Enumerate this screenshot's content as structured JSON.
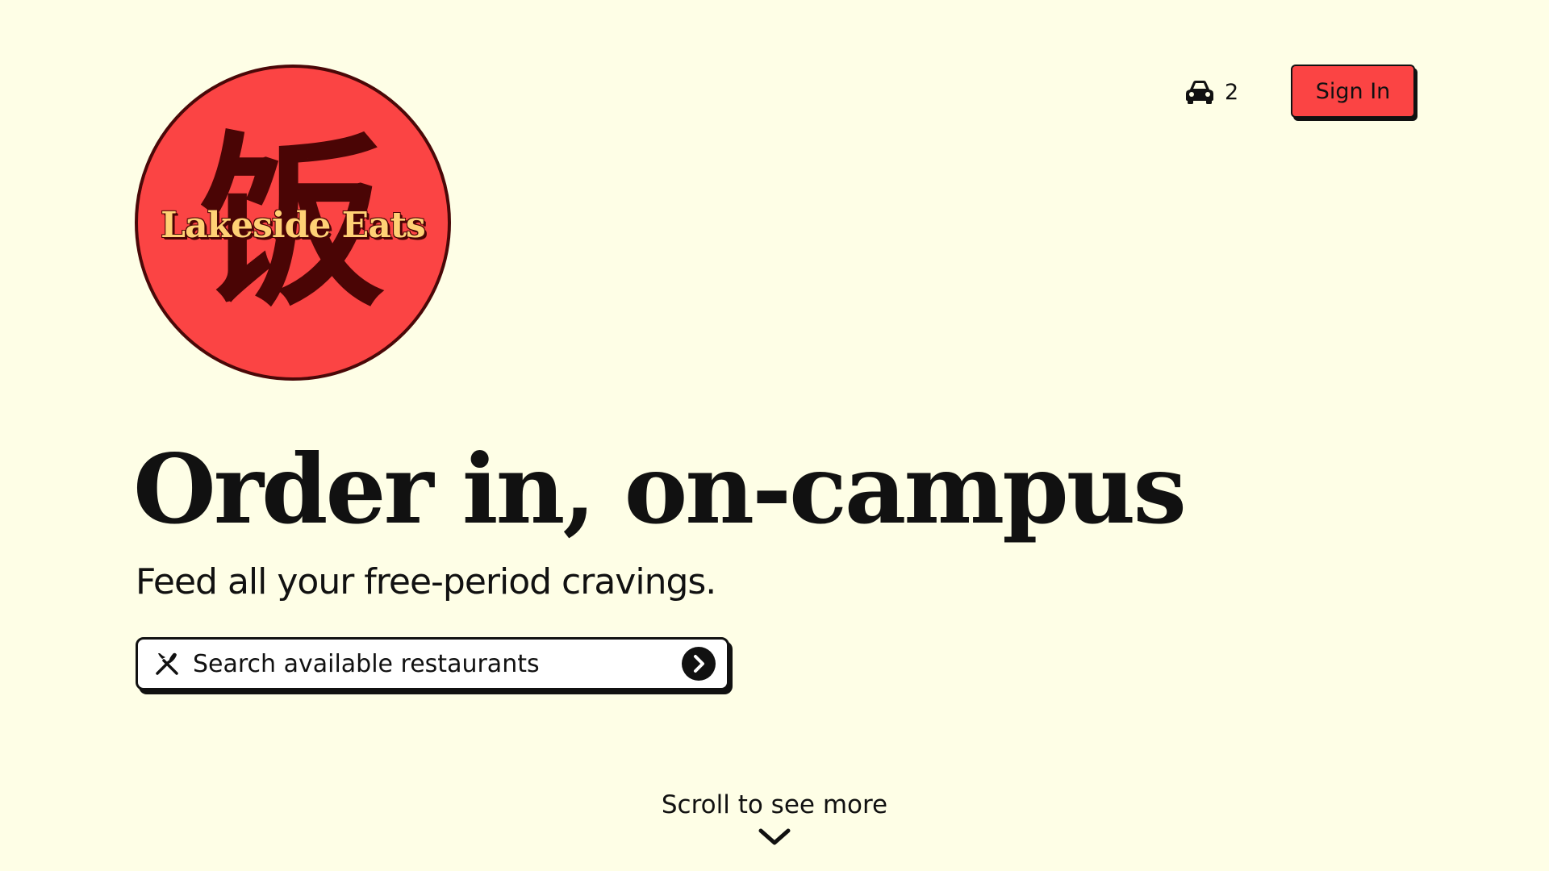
{
  "brand": {
    "logo_char": "饭",
    "logo_text": "Lakeside Eats"
  },
  "header": {
    "cart_icon": "car-icon",
    "cart_count": "2",
    "signin_label": "Sign In"
  },
  "hero": {
    "title": "Order in, on-campus",
    "subtitle": "Feed all your free-period cravings."
  },
  "search": {
    "icon": "utensils-icon",
    "placeholder": "Search available restaurants",
    "submit_icon": "chevron-right-circle-icon"
  },
  "footer": {
    "scroll_hint": "Scroll to see more",
    "scroll_icon": "chevron-down-icon"
  },
  "colors": {
    "background": "#fefee6",
    "accent": "#fb4444",
    "logo_text": "#ffd175",
    "dark": "#111111"
  }
}
